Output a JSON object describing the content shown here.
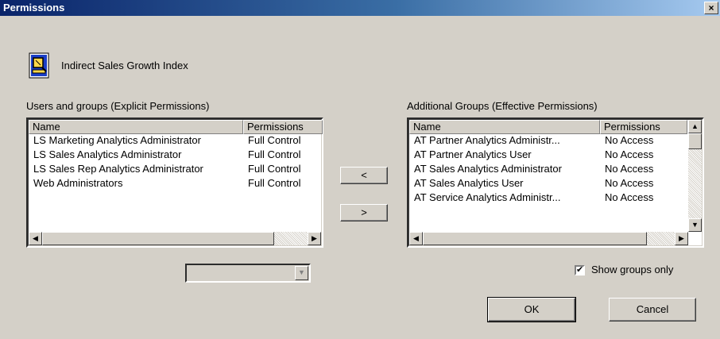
{
  "window": {
    "title": "Permissions",
    "close_glyph": "×"
  },
  "object": {
    "name": "Indirect Sales Growth Index",
    "icon": "report-magnifier-icon"
  },
  "left_list": {
    "label": "Users and groups (Explicit Permissions)",
    "columns": [
      "Name",
      "Permissions"
    ],
    "rows": [
      {
        "name": "LS Marketing Analytics Administrator",
        "perm": "Full Control"
      },
      {
        "name": "LS Sales Analytics Administrator",
        "perm": "Full Control"
      },
      {
        "name": "LS Sales Rep Analytics Administrator",
        "perm": "Full Control"
      },
      {
        "name": "Web Administrators",
        "perm": "Full Control"
      }
    ]
  },
  "right_list": {
    "label": "Additional Groups (Effective Permissions)",
    "columns": [
      "Name",
      "Permissions"
    ],
    "rows": [
      {
        "name": "AT Partner Analytics Administr...",
        "perm": "No Access"
      },
      {
        "name": "AT Partner Analytics User",
        "perm": "No Access"
      },
      {
        "name": "AT Sales Analytics Administrator",
        "perm": "No Access"
      },
      {
        "name": "AT Sales Analytics User",
        "perm": "No Access"
      },
      {
        "name": "AT Service Analytics Administr...",
        "perm": "No Access"
      }
    ]
  },
  "move": {
    "left_label": "<",
    "right_label": ">"
  },
  "permission_select": {
    "value": ""
  },
  "show_groups_only": {
    "label": "Show groups only",
    "checked": true
  },
  "buttons": {
    "ok": "OK",
    "cancel": "Cancel"
  }
}
